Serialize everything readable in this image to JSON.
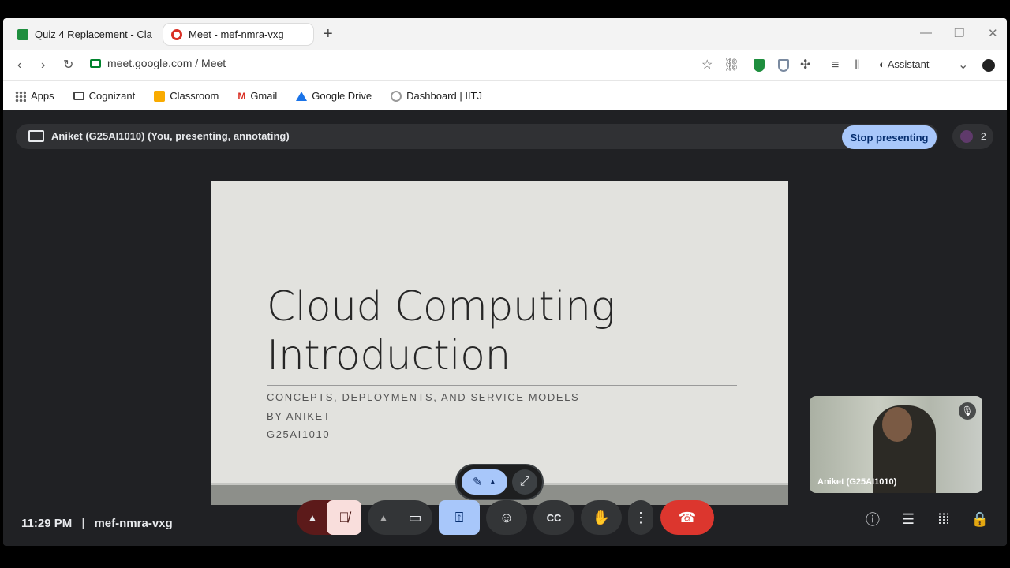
{
  "browser": {
    "tabs": [
      {
        "label": "Quiz 4 Replacement - Cla",
        "active": false
      },
      {
        "label": "Meet - mef-nmra-vxg",
        "active": true
      }
    ],
    "url": "meet.google.com / Meet",
    "assistant_label": "Assistant",
    "bookmarks": [
      "Apps",
      "Cognizant",
      "Classroom",
      "Gmail",
      "Google Drive",
      "Dashboard | IITJ"
    ]
  },
  "meet": {
    "presenting_text": "Aniket (G25AI1010) (You, presenting, annotating)",
    "stop_presenting_label": "Stop presenting",
    "participant_count": "2",
    "clock": "11:29 PM",
    "separator": "|",
    "meeting_code": "mef-nmra-vxg",
    "self_view_name": "Aniket (G25AI1010)",
    "cc_label": "CC"
  },
  "slide": {
    "title_line1": "Cloud Computing",
    "title_line2": "Introduction",
    "subtitle": "CONCEPTS, DEPLOYMENTS, AND SERVICE MODELS",
    "author": "BY ANIKET",
    "id": "G25AI1010"
  },
  "colors": {
    "stop_button": "#a8c7fa",
    "leave_button": "#dc362e",
    "muted_mic": "#f9dedc",
    "meet_bg": "#202124"
  }
}
